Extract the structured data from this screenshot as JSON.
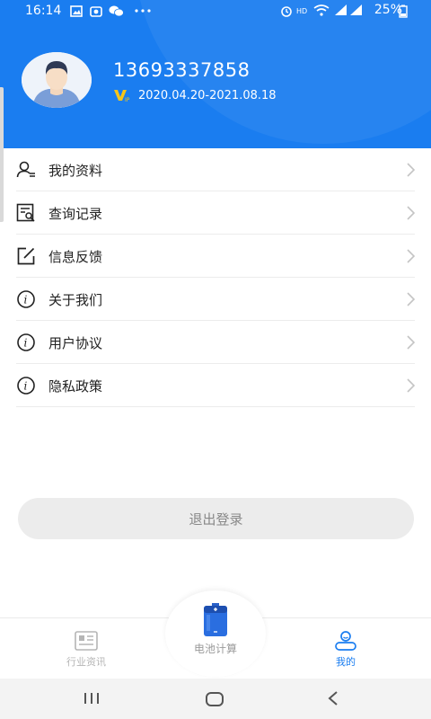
{
  "status_bar": {
    "time": "16:14",
    "battery_text": "25%",
    "icons": [
      "gallery-icon",
      "camera-icon",
      "wechat-icon",
      "more-icon",
      "alarm-icon",
      "hd-icon",
      "wifi-icon",
      "signal-icon",
      "signal-icon",
      "battery-icon"
    ]
  },
  "profile": {
    "phone": "13693337858",
    "vip_period": "2020.04.20-2021.08.18"
  },
  "menu": {
    "items": [
      {
        "label": "我的资料",
        "icon": "profile-icon"
      },
      {
        "label": "查询记录",
        "icon": "search-record-icon"
      },
      {
        "label": "信息反馈",
        "icon": "feedback-icon"
      },
      {
        "label": "关于我们",
        "icon": "info-icon"
      },
      {
        "label": "用户协议",
        "icon": "info-icon"
      },
      {
        "label": "隐私政策",
        "icon": "info-icon"
      }
    ]
  },
  "logout_label": "退出登录",
  "tabbar": {
    "news_label": "行业资讯",
    "battery_calc_label": "电池计算",
    "mine_label": "我的"
  },
  "colors": {
    "brand_blue": "#1a7df0",
    "active_tab": "#1a7df0",
    "inactive_tab": "#b5b5b5"
  }
}
